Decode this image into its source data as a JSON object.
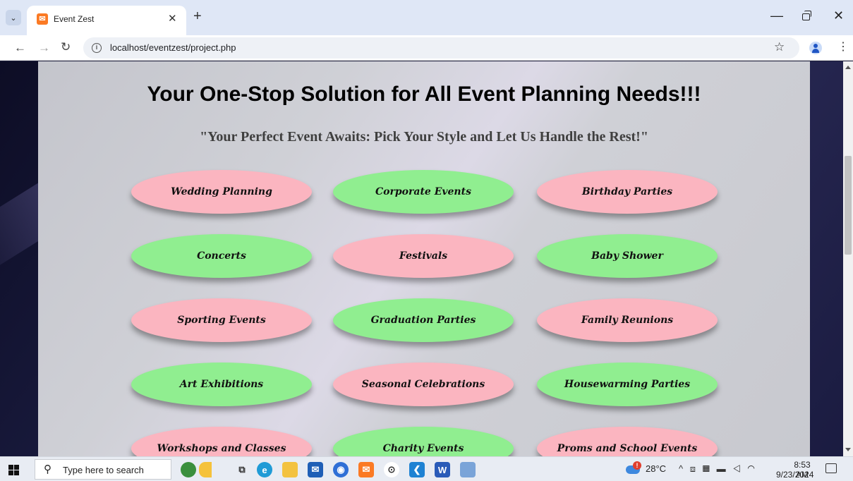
{
  "browser": {
    "tab_title": "Event Zest",
    "tab_favicon": "✉",
    "url": "localhost/eventzest/project.php"
  },
  "page": {
    "heading": "Your One-Stop Solution for All Event Planning Needs!!!",
    "subheading": "\"Your Perfect Event Awaits: Pick Your Style and Let Us Handle the Rest!\"",
    "events": [
      {
        "label": "Wedding Planning",
        "color": "pink"
      },
      {
        "label": "Corporate Events",
        "color": "green"
      },
      {
        "label": "Birthday Parties",
        "color": "pink"
      },
      {
        "label": "Concerts",
        "color": "green"
      },
      {
        "label": "Festivals",
        "color": "pink"
      },
      {
        "label": "Baby Shower",
        "color": "green"
      },
      {
        "label": "Sporting Events",
        "color": "pink"
      },
      {
        "label": "Graduation Parties",
        "color": "green"
      },
      {
        "label": "Family Reunions",
        "color": "pink"
      },
      {
        "label": "Art Exhibitions",
        "color": "green"
      },
      {
        "label": "Seasonal Celebrations",
        "color": "pink"
      },
      {
        "label": "Housewarming Parties",
        "color": "green"
      },
      {
        "label": "Workshops and Classes",
        "color": "pink"
      },
      {
        "label": "Charity Events",
        "color": "green"
      },
      {
        "label": "Proms and School Events",
        "color": "pink"
      }
    ],
    "colors": {
      "pink": "#fbb5c0",
      "green": "#90ee90"
    }
  },
  "taskbar": {
    "search_placeholder": "Type here to search",
    "temperature": "28°C",
    "time": "8:53 AM",
    "date": "9/23/2024",
    "pinned_apps": [
      "widgets-icon",
      "task-view-icon",
      "edge-icon",
      "file-explorer-icon",
      "mail-icon",
      "chrome-icon",
      "xampp-icon",
      "steam-icon",
      "vscode-icon",
      "word-icon",
      "notepad-icon"
    ]
  }
}
